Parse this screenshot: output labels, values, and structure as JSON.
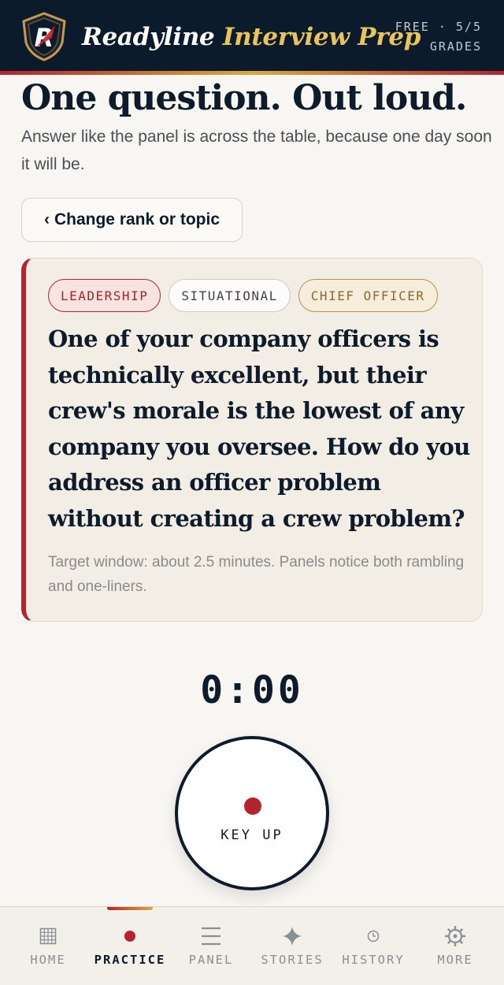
{
  "header": {
    "title_primary": "Readyline",
    "title_accent": "Interview Prep",
    "plan_line1": "FREE · 5/5",
    "plan_line2": "GRADES",
    "logo_letter": "R"
  },
  "intro": {
    "title": "One question. Out loud.",
    "subtitle": "Answer like the panel is across the table, because one day soon it will be.",
    "change_button_label": "Change rank or topic",
    "change_button_icon": "chevron-left-icon"
  },
  "question": {
    "tags": [
      "LEADERSHIP",
      "SITUATIONAL",
      "CHIEF OFFICER"
    ],
    "text": "One of your company officers is technically excellent, but their crew's morale is the lowest of any company you oversee. How do you address an officer problem without creating a crew problem?",
    "target_note": "Target window: about 2.5 minutes. Panels notice both rambling and one-liners."
  },
  "recorder": {
    "timer": "0:00",
    "button_label": "KEY UP",
    "button_icon": "record-dot-icon"
  },
  "nav": {
    "active": "practice",
    "items": [
      {
        "id": "home",
        "label": "HOME",
        "icon": "grid-icon"
      },
      {
        "id": "practice",
        "label": "PRACTICE",
        "icon": "record-dot-icon"
      },
      {
        "id": "panel",
        "label": "PANEL",
        "icon": "menu-lines-icon"
      },
      {
        "id": "stories",
        "label": "STORIES",
        "icon": "sparkle-icon"
      },
      {
        "id": "history",
        "label": "HISTORY",
        "icon": "clock-icon"
      },
      {
        "id": "more",
        "label": "MORE",
        "icon": "gear-icon"
      }
    ]
  },
  "colors": {
    "navy": "#0c1b2c",
    "gold": "#e8c45a",
    "red": "#b5232f",
    "background": "#f8f6f2",
    "card": "#f2ede5"
  }
}
